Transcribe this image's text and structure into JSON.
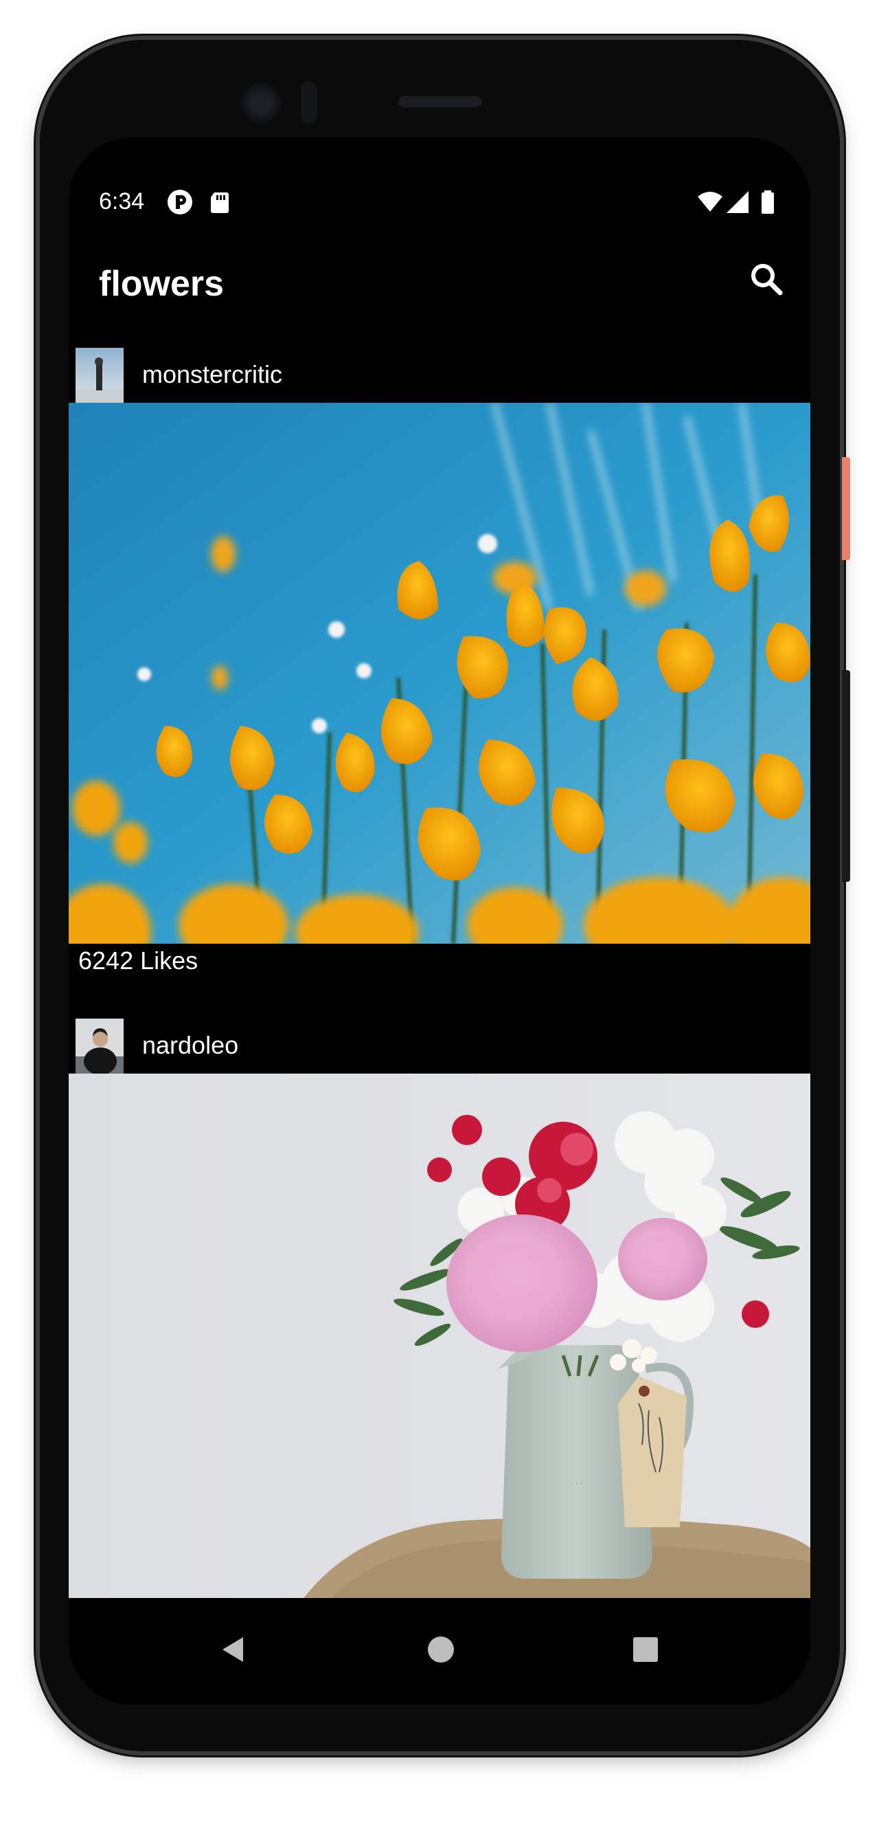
{
  "status_bar": {
    "time": "6:34"
  },
  "app_bar": {
    "title": "flowers"
  },
  "posts": [
    {
      "username": "monstercritic",
      "likes": "6242 Likes"
    },
    {
      "username": "nardoleo"
    }
  ]
}
